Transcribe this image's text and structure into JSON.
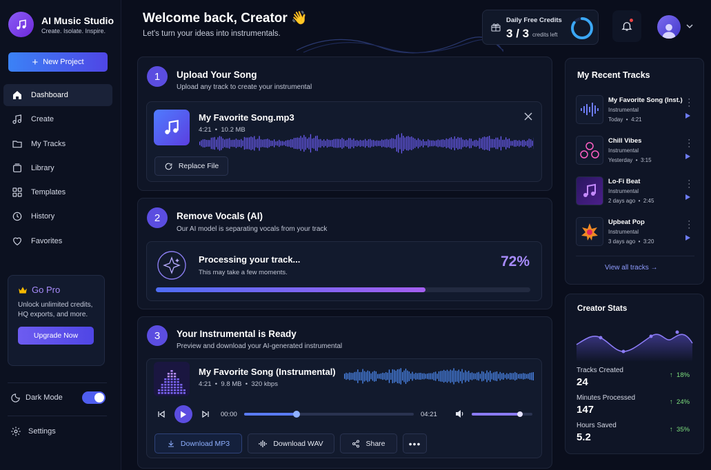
{
  "brand": {
    "name": "AI Music Studio",
    "tagline": "Create. Isolate. Inspire."
  },
  "sidebar": {
    "new_project": "New Project",
    "items": [
      {
        "label": "Dashboard",
        "icon": "home-icon"
      },
      {
        "label": "Create",
        "icon": "music-note-icon"
      },
      {
        "label": "My Tracks",
        "icon": "folder-icon"
      },
      {
        "label": "Library",
        "icon": "library-icon"
      },
      {
        "label": "Templates",
        "icon": "grid-icon"
      },
      {
        "label": "History",
        "icon": "history-icon"
      },
      {
        "label": "Favorites",
        "icon": "heart-icon"
      }
    ],
    "gopro": {
      "title": "Go Pro",
      "desc": "Unlock unlimited credits, HQ exports, and more.",
      "button": "Upgrade Now"
    },
    "dark_mode": "Dark Mode",
    "dark_mode_on": true,
    "settings": "Settings"
  },
  "header": {
    "title": "Welcome back, Creator 👋",
    "subtitle": "Let's turn your ideas into instrumentals.",
    "credits_label": "Daily Free Credits",
    "credits_used": "3",
    "credits_total": "3",
    "credits_left_label": "credits left",
    "credits_fraction": 0.85
  },
  "upload": {
    "num": "1",
    "title": "Upload Your Song",
    "subtitle": "Upload any track to create your instrumental",
    "file_name": "My Favorite Song.mp3",
    "duration": "4:21",
    "size": "10.2 MB",
    "replace": "Replace File"
  },
  "remove": {
    "num": "2",
    "title": "Remove Vocals (AI)",
    "subtitle": "Our AI model is separating vocals from your track",
    "status_title": "Processing your track...",
    "status_sub": "This may take a few moments.",
    "percent_label": "72%",
    "percent": 72
  },
  "ready": {
    "num": "3",
    "title": "Your Instrumental is Ready",
    "subtitle": "Preview and download your AI-generated instrumental",
    "file_name": "My Favorite Song (Instrumental)",
    "duration": "4:21",
    "size": "9.8 MB",
    "bitrate": "320 kbps",
    "time_current": "00:00",
    "time_total": "04:21",
    "seek_fraction": 0.31,
    "volume_fraction": 0.8,
    "download_mp3": "Download MP3",
    "download_wav": "Download WAV",
    "share": "Share"
  },
  "recent": {
    "title": "My Recent Tracks",
    "tracks": [
      {
        "name": "My Favorite Song (Inst.)",
        "type": "Instrumental",
        "when": "Today",
        "duration": "4:21"
      },
      {
        "name": "Chill Vibes",
        "type": "Instrumental",
        "when": "Yesterday",
        "duration": "3:15"
      },
      {
        "name": "Lo-Fi Beat",
        "type": "Instrumental",
        "when": "2 days ago",
        "duration": "2:45"
      },
      {
        "name": "Upbeat Pop",
        "type": "Instrumental",
        "when": "3 days ago",
        "duration": "3:20"
      }
    ],
    "view_all": "View all tracks →"
  },
  "stats": {
    "title": "Creator Stats",
    "items": [
      {
        "label": "Tracks Created",
        "value": "24",
        "delta": "18%"
      },
      {
        "label": "Minutes Processed",
        "value": "147",
        "delta": "24%"
      },
      {
        "label": "Hours Saved",
        "value": "5.2",
        "delta": "35%"
      }
    ]
  },
  "colors": {
    "accent": "#5b4de0",
    "purple": "#a78bfa",
    "positive": "#7ee07e",
    "bg": "#0a0e1c"
  }
}
